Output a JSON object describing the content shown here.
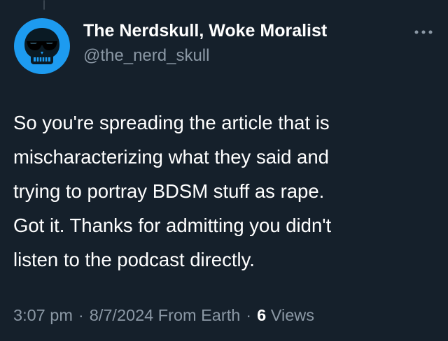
{
  "author": {
    "display_name": "The Nerdskull, Woke Moralist",
    "handle": "@the_nerd_skull",
    "avatar_icon": "skull-with-sunglasses-icon",
    "avatar_bg": "#1d9bf0"
  },
  "tweet": {
    "lines": [
      "So you're spreading the article that is",
      "mischaracterizing what they said and",
      "trying to portray BDSM stuff as rape.",
      "Got it. Thanks for admitting you didn't",
      "listen to the podcast directly."
    ]
  },
  "meta": {
    "time": "3:07 pm",
    "separator": "·",
    "date": "8/7/2024",
    "source": "From Earth",
    "views_count": "6",
    "views_label": "Views"
  },
  "menu": {
    "icon": "more-horizontal-icon"
  },
  "colors": {
    "background": "#15202b",
    "secondary_text": "#8b98a5",
    "primary_text": "#ffffff"
  }
}
